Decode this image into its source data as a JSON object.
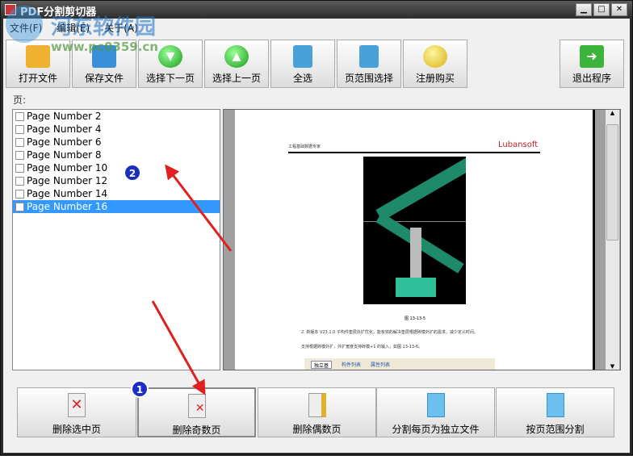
{
  "window": {
    "title": "PDF分割剪切器",
    "controls": [
      "minimize",
      "maximize",
      "close"
    ]
  },
  "menu": [
    "文件(F)",
    "编辑(E)",
    "关于(A)"
  ],
  "toolbar": [
    {
      "label": "打开文件",
      "icon": "open-folder-icon",
      "color": "#f0b030"
    },
    {
      "label": "保存文件",
      "icon": "save-disk-icon",
      "color": "#3a8fd8"
    },
    {
      "label": "选择下一页",
      "icon": "green-down-arrow-icon",
      "color": "#3cb43c"
    },
    {
      "label": "选择上一页",
      "icon": "green-up-arrow-icon",
      "color": "#3cb43c"
    },
    {
      "label": "全选",
      "icon": "select-all-pages-icon",
      "color": "#4aa0d8"
    },
    {
      "label": "页范围选择",
      "icon": "page-range-icon",
      "color": "#4aa0d8"
    },
    {
      "label": "注册购买",
      "icon": "coin-icon",
      "color": "#e8c820"
    },
    {
      "label": "退出程序",
      "icon": "exit-arrow-icon",
      "color": "#3cb43c"
    }
  ],
  "pages_label": "页:",
  "pages": [
    {
      "label": "Page Number 2",
      "checked": false,
      "selected": false
    },
    {
      "label": "Page Number 4",
      "checked": false,
      "selected": false
    },
    {
      "label": "Page Number 6",
      "checked": false,
      "selected": false
    },
    {
      "label": "Page Number 8",
      "checked": false,
      "selected": false
    },
    {
      "label": "Page Number 10",
      "checked": false,
      "selected": false
    },
    {
      "label": "Page Number 12",
      "checked": false,
      "selected": false
    },
    {
      "label": "Page Number 14",
      "checked": false,
      "selected": false
    },
    {
      "label": "Page Number 16",
      "checked": false,
      "selected": true
    }
  ],
  "preview": {
    "header_left": "工程基础数据专家",
    "logo": "Lubansoft",
    "caption": "图 13-13-5",
    "para1": "2. 新版本 V23.1.0 子构件垫层外扩优化，能有效的解决垫层根据砖模外扩的需求，减少定义时间。",
    "bullet": "支持根据砖模外扩，外扩宽度支持砖模+1 的输入，如图 13-13-6。",
    "combo": "独立基",
    "tabs": [
      "构件列表",
      "属性列表"
    ]
  },
  "bottom_buttons": [
    {
      "label": "删除选中页",
      "icon": "delete-page-icon"
    },
    {
      "label": "删除奇数页",
      "icon": "delete-odd-pages-icon"
    },
    {
      "label": "删除偶数页",
      "icon": "delete-even-pages-icon"
    },
    {
      "label": "分割每页为独立文件",
      "icon": "split-each-page-icon"
    },
    {
      "label": "按页范围分割",
      "icon": "split-by-range-icon"
    }
  ],
  "annotations": [
    "1",
    "2"
  ],
  "watermark": {
    "name": "河东软件园",
    "url": "www.pc0359.cn"
  }
}
